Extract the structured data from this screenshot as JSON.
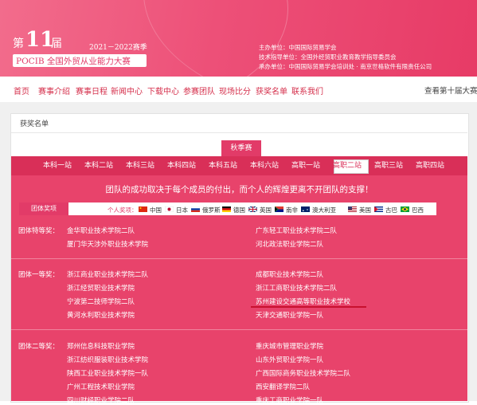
{
  "header": {
    "edition_prefix": "第",
    "edition_number": "11",
    "edition_suffix": "届",
    "season": "2021－2022赛季",
    "title": "POCIB 全国外贸从业能力大赛",
    "organizers": [
      "主办单位：中国国际贸易学会",
      "技术指导单位：全国外经贸职业教育教学指导委员会",
      "承办单位：中国国际贸易学会培训处 · 南京世格软件有限责任公司"
    ]
  },
  "nav": {
    "items": [
      "首页",
      "赛事介绍",
      "赛事日程",
      "新闻中心",
      "下载中心",
      "参赛团队",
      "现场比分",
      "获奖名单",
      "联系我们"
    ],
    "right_link": "查看第十届大赛"
  },
  "breadcrumb": "获奖名单",
  "season_tab": "秋季赛",
  "stations": {
    "items": [
      "本科一站",
      "本科二站",
      "本科三站",
      "本科四站",
      "本科五站",
      "本科六站",
      "高职一站",
      "高职二站",
      "高职三站",
      "高职四站"
    ],
    "active": "高职二站"
  },
  "slogan": "团队的成功取决于每个成员的付出，而个人的辉煌更离不开团队的支撑！",
  "awards_bar": {
    "team_label": "团体奖项",
    "individual_label": "个人奖项：",
    "countries": [
      "中国",
      "日本",
      "俄罗斯",
      "德国",
      "英国",
      "南非",
      "澳大利亚",
      "美国",
      "古巴",
      "巴西"
    ]
  },
  "categories": [
    {
      "label": "团体特等奖：",
      "left": [
        "金华职业技术学院二队",
        "厦门华天涉外职业技术学院"
      ],
      "right": [
        "广东轻工职业技术学院二队",
        "河北政法职业学院二队"
      ]
    },
    {
      "label": "团体一等奖：",
      "left": [
        "浙江商业职业技术学院二队",
        "浙江经贸职业技术学院",
        "宁波第二技师学院二队",
        "黄河水利职业技术学院"
      ],
      "right": [
        "成都职业技术学院二队",
        "浙江工商职业技术学院二队",
        "苏州建设交通高等职业技术学校",
        "天津交通职业学院一队"
      ]
    },
    {
      "label": "团体二等奖：",
      "left": [
        "郑州信息科技职业学院",
        "浙江纺织服装职业技术学院",
        "陕西工业职业技术学院一队",
        "广州工程技术职业学院",
        "四川财经职业学院二队"
      ],
      "right": [
        "重庆城市管理职业学院",
        "山东外贸职业学院一队",
        "广西国际商务职业技术学院二队",
        "西安翻译学院二队",
        "重庆工商职业学院一队"
      ]
    }
  ],
  "colors": {
    "brand": "#e23b68",
    "band": "#e8436b",
    "highlight_underline": "#c8102e"
  }
}
